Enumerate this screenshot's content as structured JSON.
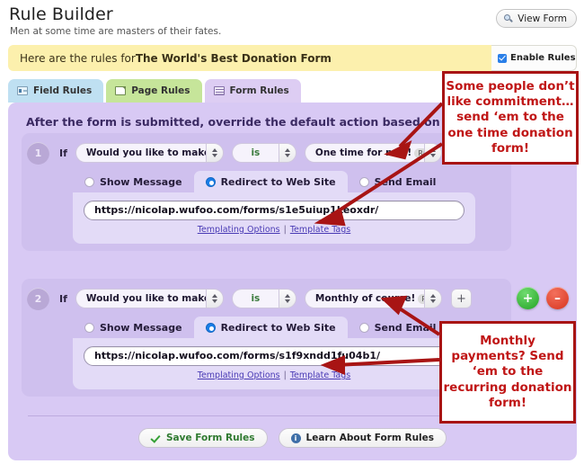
{
  "header": {
    "title": "Rule Builder",
    "subtitle": "Men at some time are masters of their fates.",
    "view_form_label": "View Form"
  },
  "banner": {
    "prefix": "Here are the rules for ",
    "form_name": "The World's Best Donation Form",
    "enable_label": "Enable Rules",
    "enable_checked": true
  },
  "tabs": [
    {
      "label": "Field Rules",
      "icon": "field-rules-icon",
      "active": false
    },
    {
      "label": "Page Rules",
      "icon": "page-rules-icon",
      "active": false
    },
    {
      "label": "Form Rules",
      "icon": "form-rules-icon",
      "active": true
    }
  ],
  "panel": {
    "intro": "After the form is submitted, override the default action based on these rules."
  },
  "rules": [
    {
      "number": "1",
      "if_label": "If",
      "field": "Would you like to make a",
      "field_type": "Radio",
      "operator": "is",
      "value": "One time for now!",
      "value_type": "Radio",
      "add_label": "+",
      "actions": [
        {
          "label": "Show Message",
          "selected": false
        },
        {
          "label": "Redirect to Web Site",
          "selected": true
        },
        {
          "label": "Send Email",
          "selected": false
        }
      ],
      "url": "https://nicolap.wufoo.com/forms/s1e5uiup1keoxdr/",
      "templating_options": "Templating Options",
      "template_tags": "Template Tags"
    },
    {
      "number": "2",
      "if_label": "If",
      "field": "Would you like to make a",
      "field_type": "Radio",
      "operator": "is",
      "value": "Monthly of course!",
      "value_type": "Radio",
      "add_label": "+",
      "actions": [
        {
          "label": "Show Message",
          "selected": false
        },
        {
          "label": "Redirect to Web Site",
          "selected": true
        },
        {
          "label": "Send Email",
          "selected": false
        }
      ],
      "url": "https://nicolap.wufoo.com/forms/s1f9xndd1fu04b1/",
      "templating_options": "Templating Options",
      "template_tags": "Template Tags",
      "add_rule_label": "+",
      "remove_rule_label": "–"
    }
  ],
  "footer": {
    "save_label": "Save Form Rules",
    "learn_label": "Learn About Form Rules",
    "info_glyph": "i"
  },
  "annotations": [
    {
      "text": "Some people don’t like commitment… send ‘em to the one time donation form!"
    },
    {
      "text": "Monthly payments? Send ‘em to the recurring donation form!"
    }
  ],
  "colors": {
    "panel": "#d8c9f4",
    "rule_block": "#cfc0ee",
    "banner": "#fcf0ad",
    "annotation_red": "#c01616",
    "accent_blue": "#1a7ee8"
  }
}
